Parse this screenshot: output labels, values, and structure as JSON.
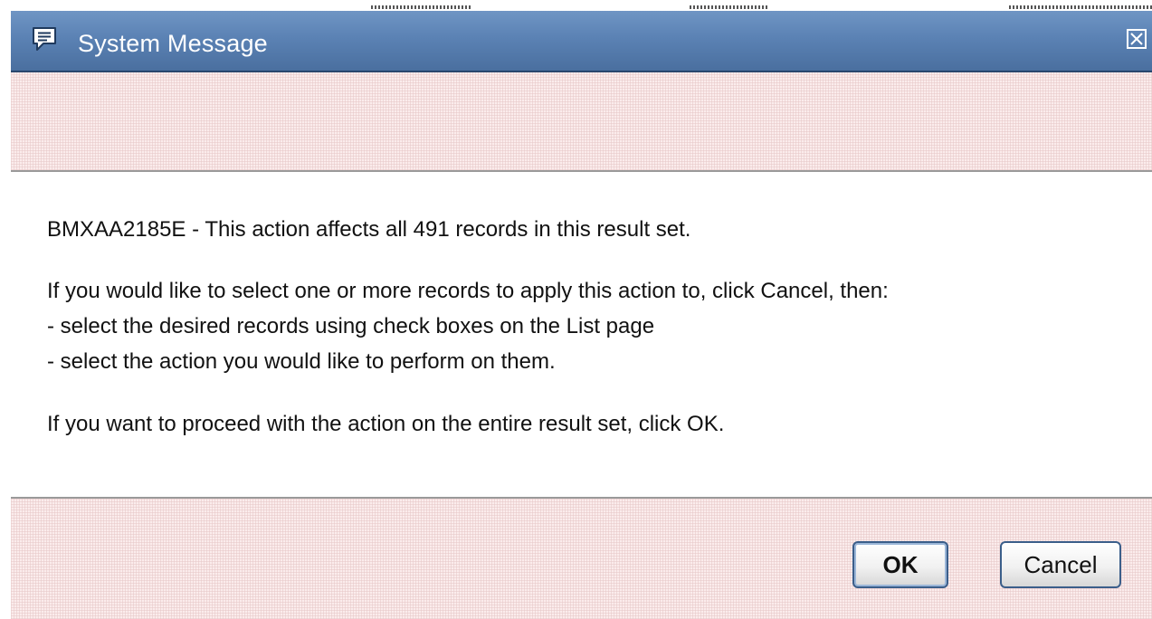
{
  "dialog": {
    "title": "System Message",
    "icon": "message-icon",
    "close_icon": "close-icon"
  },
  "message": {
    "line1": "BMXAA2185E - This action affects all 491 records in this result set.",
    "line2": "If you would like to select one or more records to apply this action to, click Cancel, then:",
    "line3": "- select the desired records using check boxes on the List page",
    "line4": "- select the action you would like to perform on them.",
    "line5": "If you want to proceed with the action on the entire result set, click OK."
  },
  "buttons": {
    "ok_label": "OK",
    "cancel_label": "Cancel"
  },
  "colors": {
    "titlebar": "#5b82b4",
    "pattern_background": "#fbecec",
    "button_border": "#3b5e8a"
  }
}
